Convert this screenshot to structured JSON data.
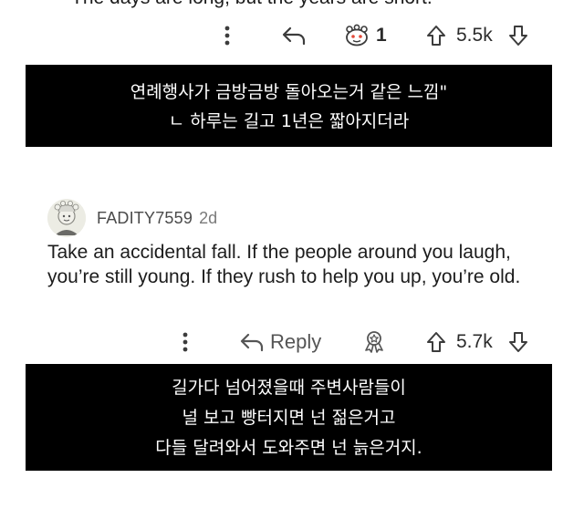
{
  "top_clipped_text": "The days are long, but the years are short.\"",
  "post1_actions": {
    "more_icon": "vertical-ellipsis-icon",
    "share_icon": "share-arrow-icon",
    "award_icon": "award-icon",
    "award_count": "1",
    "upvote_icon": "upvote-arrow-icon",
    "vote_count": "5.5k",
    "downvote_icon": "downvote-arrow-icon"
  },
  "caption1": {
    "line1": "연례행사가 금방금방 돌아오는거 같은 느낌\"",
    "line2": "ㄴ 하루는 길고 1년은 짧아지더라"
  },
  "comment": {
    "username": "FADITY7559",
    "time": "2d",
    "body": "Take an accidental fall. If the people around you laugh, you’re still young. If they rush to help you up, you’re old."
  },
  "comment_actions": {
    "more_icon": "vertical-ellipsis-icon",
    "reply_icon": "reply-arrow-icon",
    "reply_label": "Reply",
    "award_icon": "award-icon",
    "upvote_icon": "upvote-arrow-icon",
    "vote_count": "5.7k",
    "downvote_icon": "downvote-arrow-icon"
  },
  "caption2": {
    "line1": "길가다 넘어졌을때 주변사람들이",
    "line2": "널 보고 빵터지면 넌 젊은거고",
    "line3": "다들 달려와서 도와주면 넌 늙은거지."
  }
}
